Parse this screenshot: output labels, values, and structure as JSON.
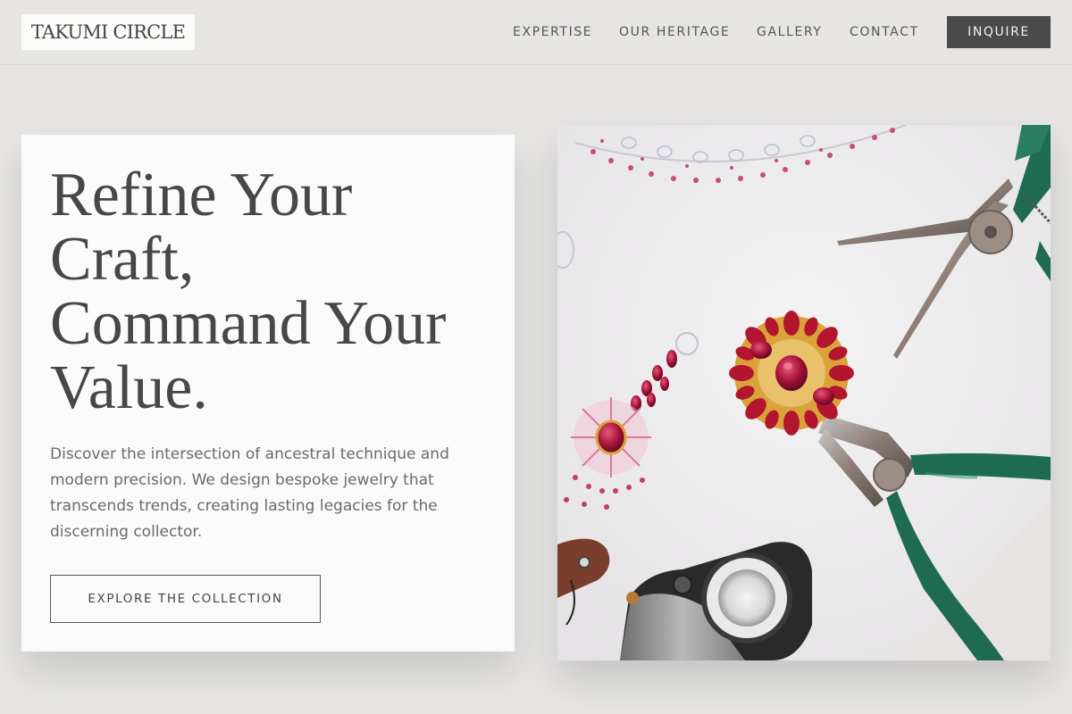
{
  "brand": {
    "logo": "TAKUMI CIRCLE"
  },
  "nav": {
    "links": [
      "EXPERTISE",
      "OUR HERITAGE",
      "GALLERY",
      "CONTACT"
    ],
    "cta": "INQUIRE"
  },
  "hero": {
    "headline_lines": [
      "Refine Your",
      "Craft,",
      "Command Your",
      "Value."
    ],
    "description_lines": [
      "Discover the intersection of ancestral technique and",
      "modern precision. We design bespoke jewelry that",
      "transcends trends, creating lasting legacies for the",
      "discerning collector."
    ],
    "cta": "EXPLORE THE COLLECTION"
  },
  "image": {
    "subject": "jeweler tools with ruby brooch on sketch paper"
  },
  "colors": {
    "background": "#e6e5e3",
    "card": "#fafafa",
    "dark_button": "#4a4a4a",
    "ruby": "#b3152f",
    "gold": "#d9a23a",
    "green_handle": "#1f6b52"
  }
}
